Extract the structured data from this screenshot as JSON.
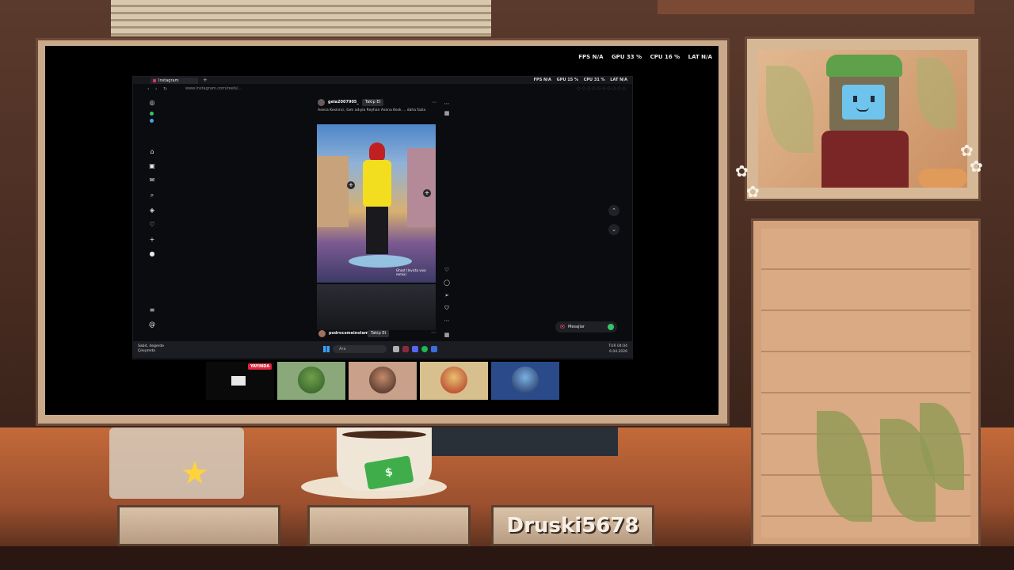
{
  "overlay": {
    "stats": [
      "FPS N/A",
      "GPU 33 %",
      "CPU 16 %",
      "LAT N/A"
    ],
    "username": "Druski5678"
  },
  "browser": {
    "tab_title": "Instagram",
    "new_tab": "+",
    "url": "www.instagram.com/reels/...",
    "stats": [
      "FPS N/A",
      "GPU 15 %",
      "CPU 31 %",
      "LAT N/A"
    ]
  },
  "instagram": {
    "sidebar_icons": [
      "instagram-logo-icon",
      "home-icon",
      "reels-icon",
      "messages-icon",
      "search-icon",
      "explore-icon",
      "heart-icon",
      "create-icon",
      "profile-icon",
      "menu-icon",
      "threads-icon"
    ],
    "reel": {
      "username": "gela2007905_",
      "follow_label": "Takip Et",
      "caption": "Asena Keskinci, tam adıyla Reyhan Asena Kesk ... daha fazla",
      "video_tag": "Ghost (Invicta viva remix)",
      "next_username": "podrocsmeinolam",
      "next_follow_label": "Takip Et"
    },
    "messages_label": "Mesajlar"
  },
  "taskbar": {
    "weather_line1": "Sabit, değerde",
    "weather_line2": "Çıkışımda",
    "search_placeholder": "Ara",
    "tray_lang": "TUR",
    "tray_time": "04:04",
    "tray_date": "6.04.2026"
  },
  "participants": {
    "live_badge": "YAYINDA"
  }
}
